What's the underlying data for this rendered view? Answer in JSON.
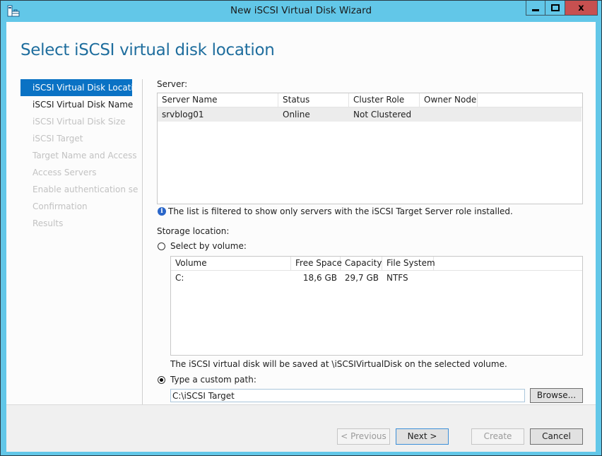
{
  "window": {
    "title": "New iSCSI Virtual Disk Wizard",
    "minimize_label": "minimize",
    "maximize_label": "maximize",
    "close_glyph": "x"
  },
  "page": {
    "title": "Select iSCSI virtual disk location"
  },
  "nav": {
    "items": [
      {
        "label": "iSCSI Virtual Disk Location",
        "state": "active"
      },
      {
        "label": "iSCSI Virtual Disk Name",
        "state": "enabled"
      },
      {
        "label": "iSCSI Virtual Disk Size",
        "state": "disabled"
      },
      {
        "label": "iSCSI Target",
        "state": "disabled"
      },
      {
        "label": "Target Name and Access",
        "state": "disabled"
      },
      {
        "label": "Access Servers",
        "state": "disabled"
      },
      {
        "label": "Enable authentication ser...",
        "state": "disabled"
      },
      {
        "label": "Confirmation",
        "state": "disabled"
      },
      {
        "label": "Results",
        "state": "disabled"
      }
    ]
  },
  "server": {
    "label": "Server:",
    "columns": [
      "Server Name",
      "Status",
      "Cluster Role",
      "Owner Node"
    ],
    "rows": [
      [
        "srvblog01",
        "Online",
        "Not Clustered",
        ""
      ]
    ],
    "info_text": "The list is filtered to show only servers with the iSCSI Target Server role installed."
  },
  "storage": {
    "label": "Storage location:",
    "select_by_volume": {
      "label": "Select by volume:",
      "checked": false
    },
    "volume_columns": [
      "Volume",
      "Free Space",
      "Capacity",
      "File System"
    ],
    "volume_rows": [
      [
        "C:",
        "18,6 GB",
        "29,7 GB",
        "NTFS"
      ]
    ],
    "volume_note": "The iSCSI virtual disk will be saved at \\iSCSIVirtualDisk on the selected volume.",
    "custom_path": {
      "label": "Type a custom path:",
      "checked": true,
      "value": "C:\\iSCSI Target"
    },
    "browse_label": "Browse..."
  },
  "footer": {
    "previous_label": "< Previous",
    "next_label": "Next >",
    "create_label": "Create",
    "cancel_label": "Cancel"
  },
  "colors": {
    "frame": "#62c7e8",
    "accent": "#0a72c4",
    "title": "#1f6e9e",
    "close": "#c75050"
  }
}
